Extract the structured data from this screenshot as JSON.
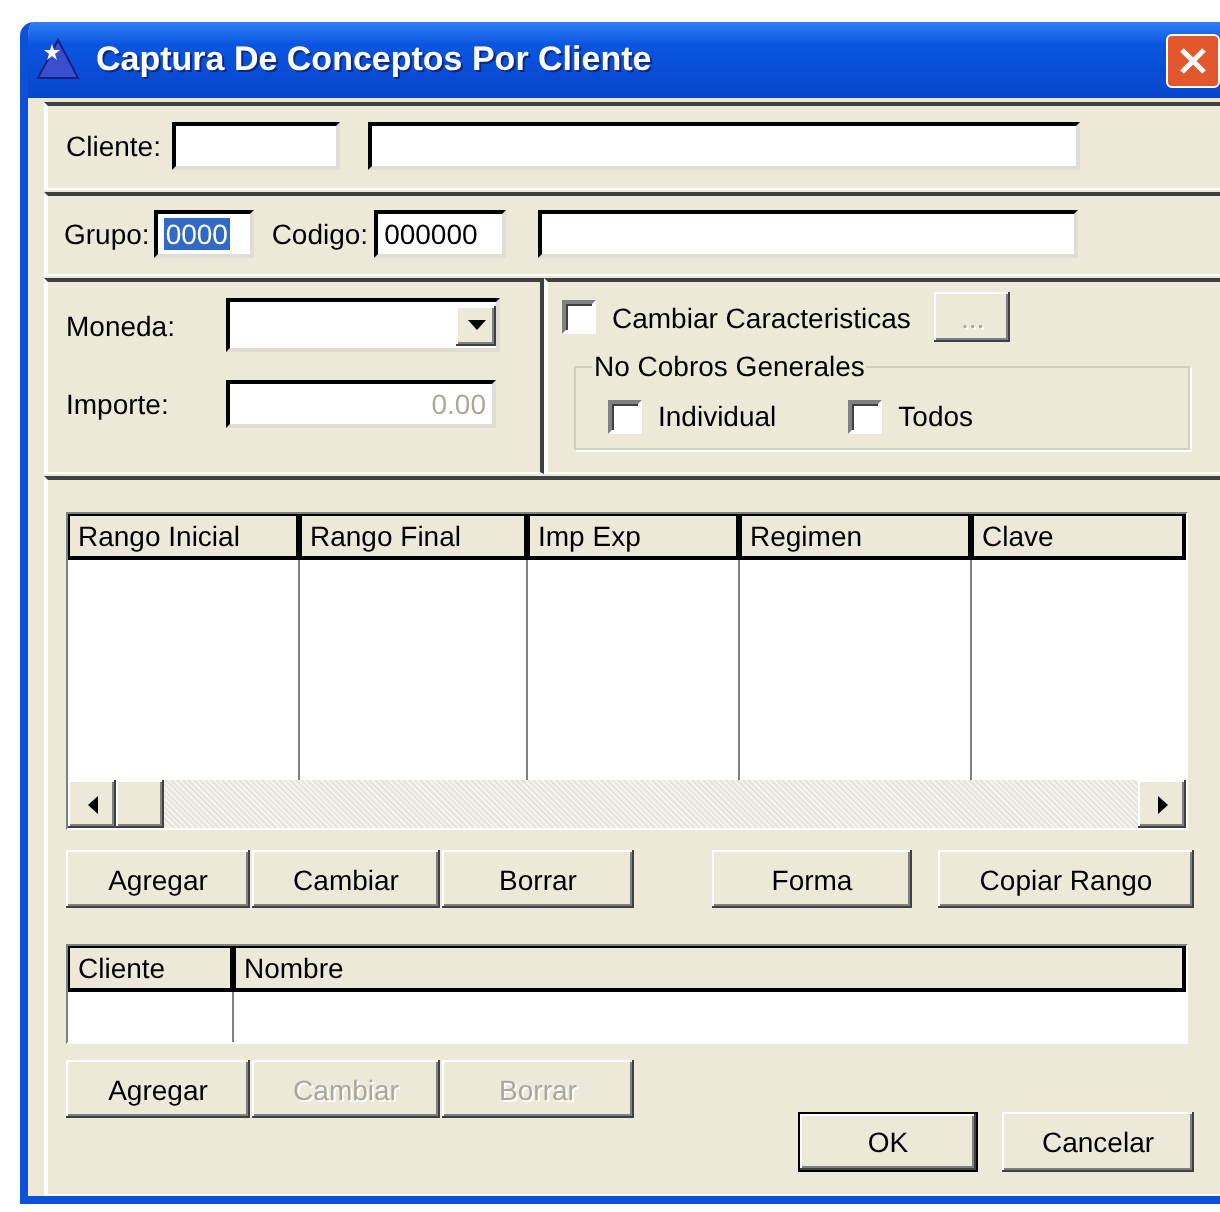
{
  "window": {
    "title": "Captura De Conceptos Por Cliente"
  },
  "cliente_row": {
    "label": "Cliente:"
  },
  "grupo_row": {
    "grupo_label": "Grupo:",
    "grupo_value": "0000",
    "grupo_selected": true,
    "codigo_label": "Codigo:",
    "codigo_value": "000000"
  },
  "moneda": {
    "label": "Moneda:"
  },
  "importe": {
    "label": "Importe:",
    "value": "0.00",
    "disabled": true
  },
  "cambiar_caracteristicas": {
    "label": "Cambiar Caracteristicas",
    "checked": false,
    "button": {
      "label": "...",
      "disabled": true
    }
  },
  "no_cobros_generales": {
    "title": "No Cobros Generales",
    "options": [
      {
        "label": "Individual",
        "checked": false
      },
      {
        "label": "Todos",
        "checked": false
      }
    ]
  },
  "ranges_table": {
    "columns": [
      "Rango Inicial",
      "Rango Final",
      "Imp Exp",
      "Regimen",
      "Clave"
    ]
  },
  "ranges_edit_buttons": [
    {
      "label": "Agregar",
      "disabled": false
    },
    {
      "label": "Cambiar",
      "disabled": false
    },
    {
      "label": "Borrar",
      "disabled": false
    }
  ],
  "ranges_extra_buttons": [
    {
      "label": "Forma",
      "disabled": false
    },
    {
      "label": "Copiar Rango",
      "disabled": false
    }
  ],
  "clients_table": {
    "columns": [
      "Cliente",
      "Nombre"
    ]
  },
  "clients_buttons": [
    {
      "label": "Agregar",
      "disabled": false
    },
    {
      "label": "Cambiar",
      "disabled": true
    },
    {
      "label": "Borrar",
      "disabled": true
    }
  ],
  "dialog_buttons": [
    {
      "label": "OK",
      "default": true
    },
    {
      "label": "Cancelar",
      "default": false
    }
  ]
}
